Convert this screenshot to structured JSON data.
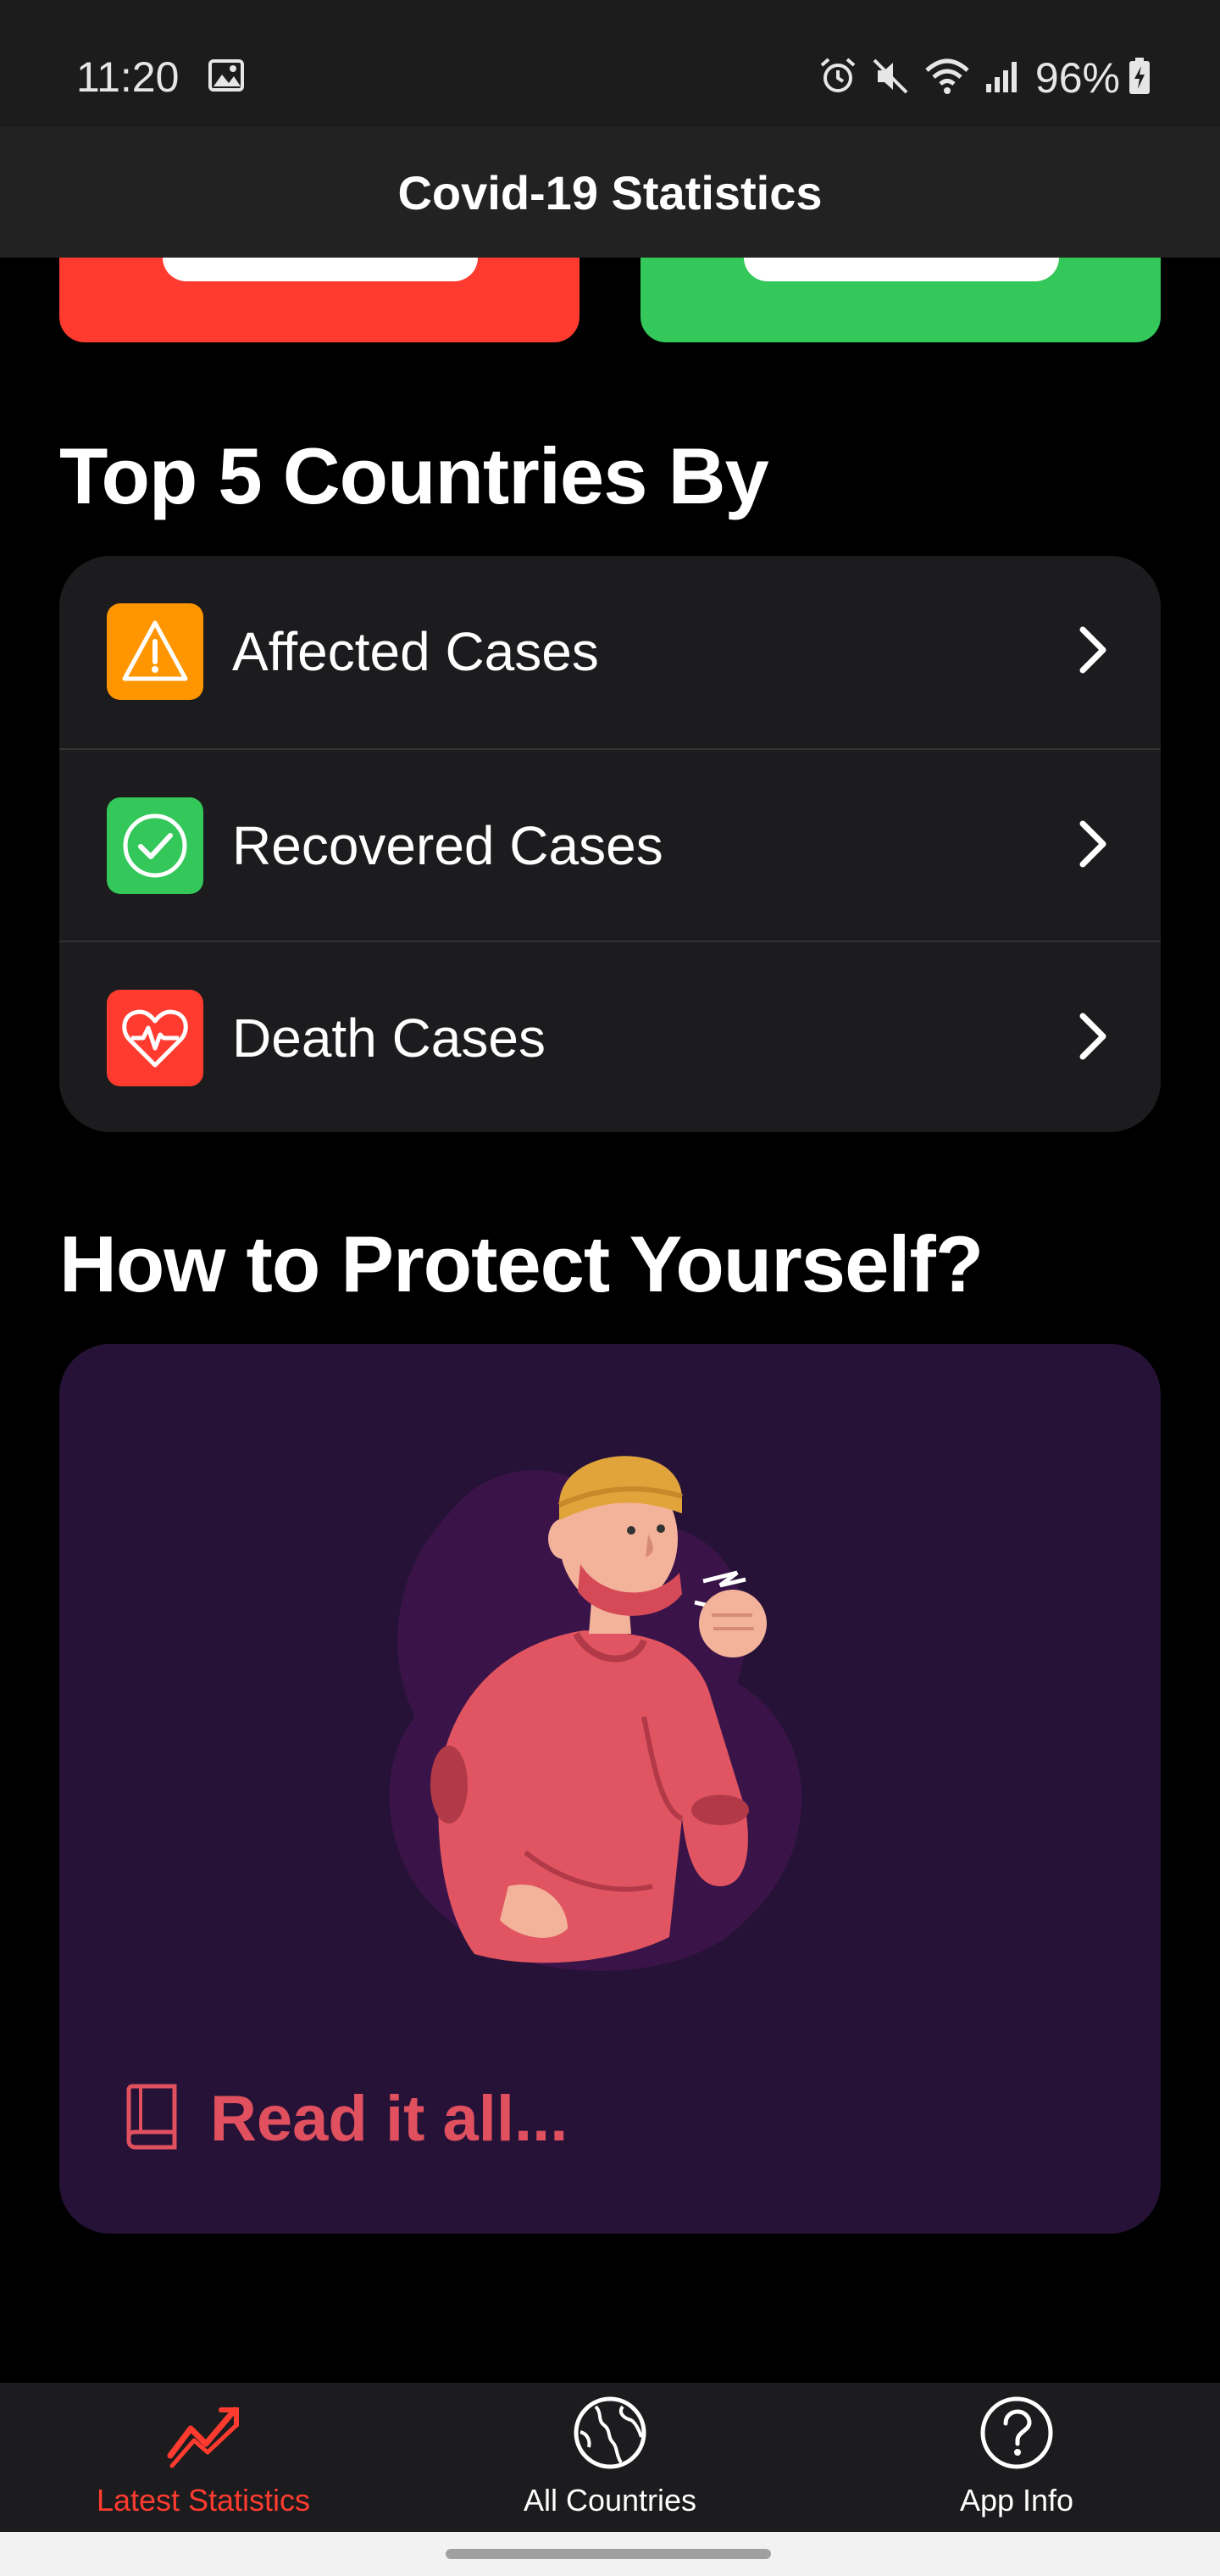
{
  "status_bar": {
    "time": "11:20",
    "battery": "96%",
    "icons": [
      "image-icon",
      "alarm-icon",
      "mute-icon",
      "wifi-icon",
      "signal-icon",
      "battery-charging-icon"
    ]
  },
  "header": {
    "title": "Covid-19 Statistics"
  },
  "stat_cards": [
    {
      "color": "#ff3b30"
    },
    {
      "color": "#34c759"
    }
  ],
  "top5": {
    "title": "Top 5 Countries By",
    "items": [
      {
        "label": "Affected Cases",
        "icon": "warning-icon",
        "color": "#ff9500"
      },
      {
        "label": "Recovered Cases",
        "icon": "check-circle-icon",
        "color": "#34c759"
      },
      {
        "label": "Death Cases",
        "icon": "heartbeat-icon",
        "color": "#ff3b30"
      }
    ]
  },
  "protect": {
    "title": "How to Protect Yourself?",
    "link_label": "Read it all...",
    "link_icon": "book-icon",
    "accent": "#e0505e"
  },
  "bottom_nav": {
    "items": [
      {
        "label": "Latest Statistics",
        "icon": "trend-icon",
        "active": true
      },
      {
        "label": "All Countries",
        "icon": "globe-icon",
        "active": false
      },
      {
        "label": "App Info",
        "icon": "help-icon",
        "active": false
      }
    ],
    "active_color": "#ff3b30"
  }
}
